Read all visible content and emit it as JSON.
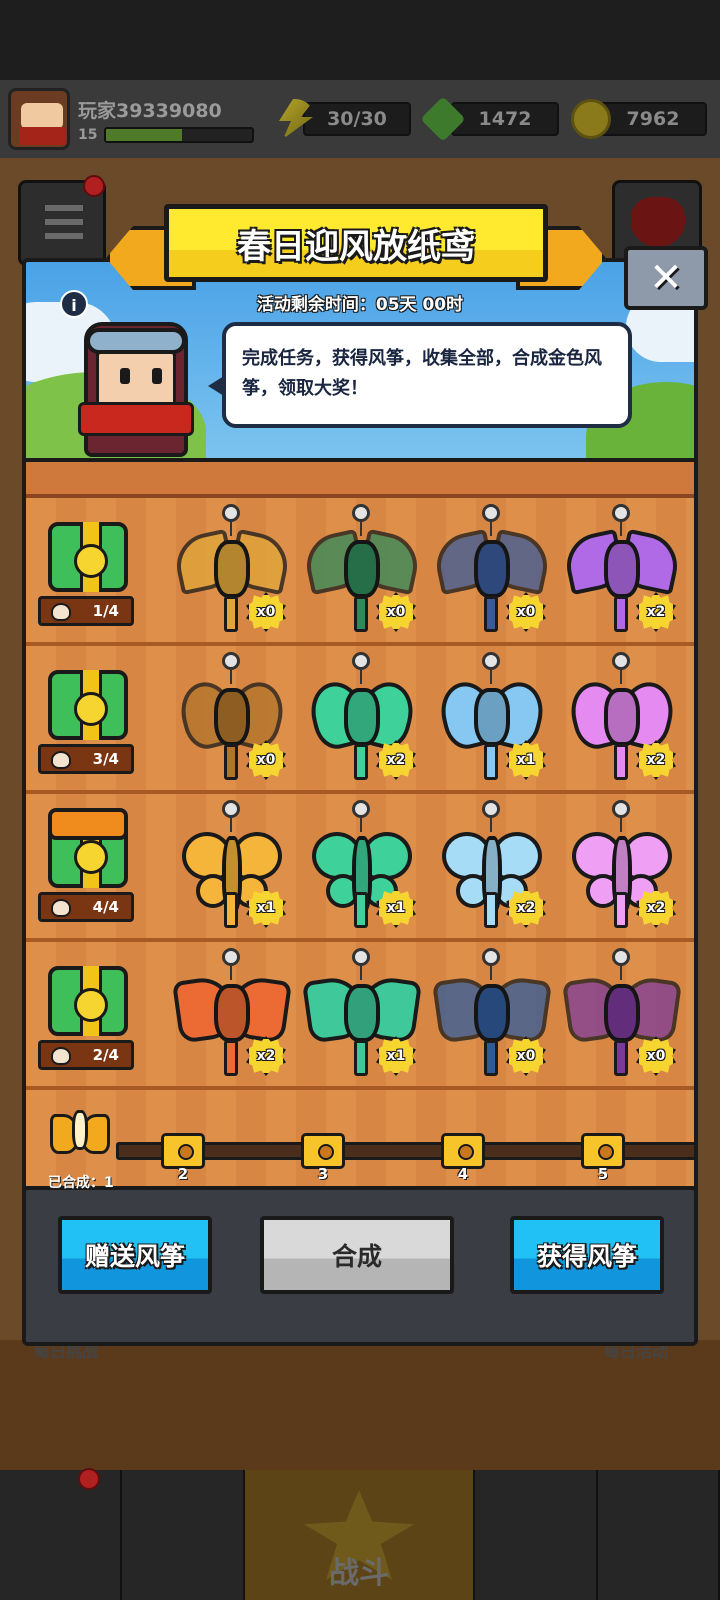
{
  "status": {
    "player_name": "玩家39339080",
    "level": "15",
    "energy": "30/30",
    "gems": "1472",
    "coins": "7962"
  },
  "event": {
    "title": "春日迎风放纸鸢",
    "timer": "活动剩余时间：05天 00时",
    "description": "完成任务，获得风筝，收集全部，合成金色风筝，领取大奖！",
    "close_symbol": "✕",
    "info_symbol": "i"
  },
  "rows": [
    {
      "type": "bat",
      "chest_open": false,
      "chest_count": "1/4",
      "kites": [
        {
          "color": "#e0a63a",
          "count": "x0"
        },
        {
          "color": "#2f8a5a",
          "count": "x0"
        },
        {
          "color": "#3b5a9a",
          "count": "x0"
        },
        {
          "color": "#b06ae6",
          "count": "x2"
        }
      ]
    },
    {
      "type": "moth",
      "chest_open": false,
      "chest_count": "3/4",
      "kites": [
        {
          "color": "#b0742a",
          "count": "x0"
        },
        {
          "color": "#3fd19a",
          "count": "x2"
        },
        {
          "color": "#86c8f2",
          "count": "x1"
        },
        {
          "color": "#e58af0",
          "count": "x2"
        }
      ]
    },
    {
      "type": "bfly",
      "chest_open": true,
      "chest_count": "4/4",
      "kites": [
        {
          "color": "#f5b43a",
          "count": "x1"
        },
        {
          "color": "#3fd19a",
          "count": "x1"
        },
        {
          "color": "#a6dcf6",
          "count": "x2"
        },
        {
          "color": "#f0a0f4",
          "count": "x2"
        }
      ]
    },
    {
      "type": "bird",
      "chest_open": false,
      "chest_count": "2/4",
      "kites": [
        {
          "color": "#ec6a34",
          "count": "x2"
        },
        {
          "color": "#3fc99a",
          "count": "x1"
        },
        {
          "color": "#2f5a9a",
          "count": "x0"
        },
        {
          "color": "#7a3a9a",
          "count": "x0"
        }
      ]
    }
  ],
  "progress": {
    "merged_label": "已合成：1",
    "milestones": [
      "2",
      "3",
      "4",
      "5"
    ]
  },
  "buttons": {
    "gift": "赠送风筝",
    "merge": "合成",
    "get": "获得风筝"
  },
  "bottom_nav": {
    "battle": "战斗"
  },
  "bg_labels": {
    "daily_challenge": "每日挑战",
    "daily_event": "每日活动"
  },
  "colors": {
    "accent_blue": "#21c0f5",
    "banner_yellow": "#ffea30",
    "chest_green": "#3fbf5a"
  }
}
